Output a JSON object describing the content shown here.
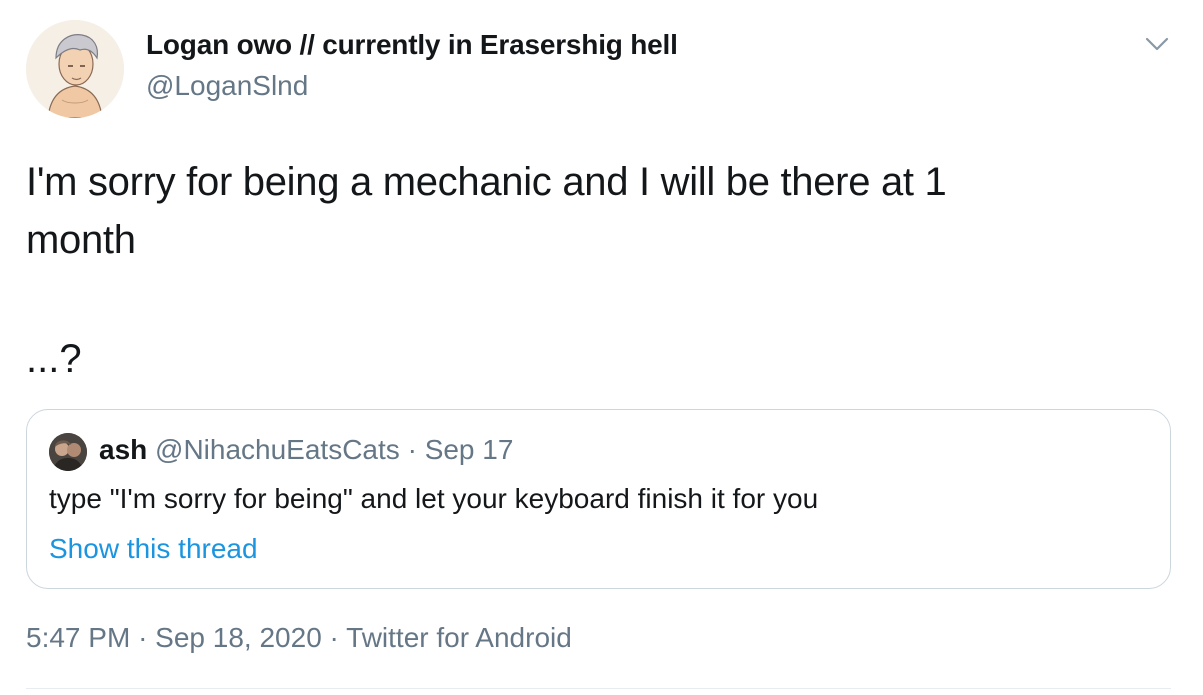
{
  "tweet": {
    "author": {
      "display_name": "Logan owo // currently in Erasershig hell",
      "handle": "@LoganSlnd",
      "avatar_icon": "avatar-illustration-icon"
    },
    "menu_icon": "chevron-down-icon",
    "text_line1": "I'm sorry for being a mechanic and I will be there at 1",
    "text_line2": "month",
    "text_line3": "...?",
    "quoted": {
      "name": "ash",
      "handle": "@NihachuEatsCats",
      "separator": "·",
      "date": "Sep 17",
      "text": "type \"I'm sorry for being\" and let your keyboard finish it for you",
      "link": "Show this thread"
    },
    "meta": {
      "time": "5:47 PM",
      "separator": "·",
      "date": "Sep 18, 2020",
      "source": "Twitter for Android"
    }
  },
  "colors": {
    "text_primary": "#14171a",
    "text_secondary": "#657786",
    "link": "#1b95e0",
    "border": "#ccd6dd"
  }
}
